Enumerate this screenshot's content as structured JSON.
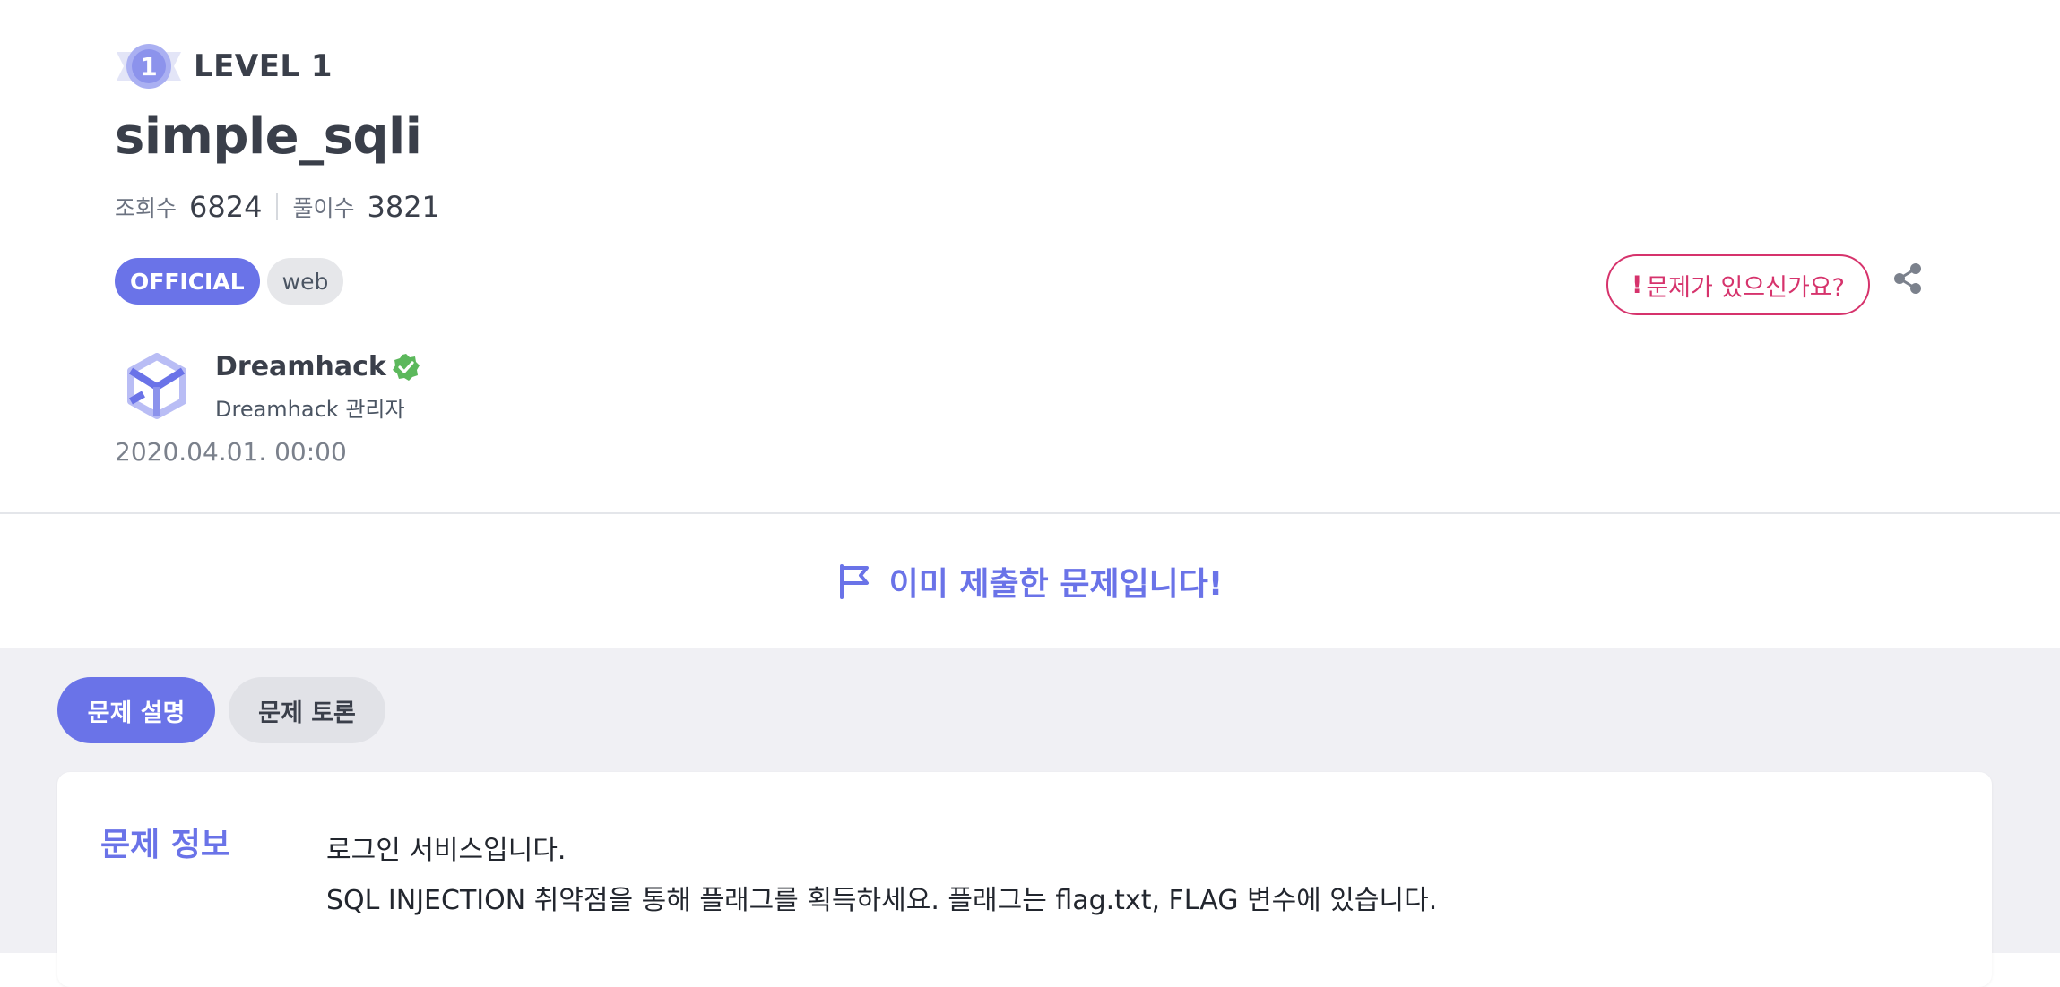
{
  "challenge": {
    "level_label": "LEVEL 1",
    "level_number": "1",
    "title": "simple_sqli",
    "views_label": "조회수",
    "views": "6824",
    "solves_label": "풀이수",
    "solves": "3821",
    "tags": [
      "OFFICIAL",
      "web"
    ],
    "report_label": "문제가 있으신가요?",
    "report_mark": "!",
    "author_name": "Dreamhack",
    "author_role": "Dreamhack 관리자",
    "date": "2020.04.01. 00:00",
    "submitted_text": "이미 제출한 문제입니다!"
  },
  "tabs": [
    {
      "label": "문제 설명",
      "active": true
    },
    {
      "label": "문제 토론",
      "active": false
    }
  ],
  "info": {
    "heading": "문제 정보",
    "lines": [
      "로그인 서비스입니다.",
      "SQL INJECTION 취약점을 통해 플래그를 획득하세요. 플래그는 flag.txt, FLAG 변수에 있습니다."
    ]
  },
  "colors": {
    "accent": "#6a73e8",
    "report": "#d6336c",
    "verified": "#5cb85c",
    "lower_bg": "#f0f0f4"
  },
  "icons": [
    "level-badge-icon",
    "share-icon",
    "dreamhack-logo",
    "verified-icon",
    "flag-icon"
  ]
}
